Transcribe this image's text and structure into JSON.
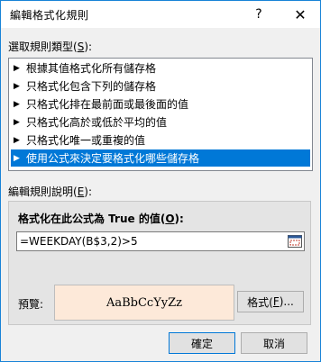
{
  "window": {
    "title": "編輯格式化規則",
    "help_glyph": "?",
    "close_glyph": "✕"
  },
  "rule_type": {
    "label": "選取規則類型(",
    "hotkey": "S",
    "label_end": "):",
    "items": [
      {
        "label": "根據其值格式化所有儲存格",
        "selected": false
      },
      {
        "label": "只格式化包含下列的儲存格",
        "selected": false
      },
      {
        "label": "只格式化排在最前面或最後面的值",
        "selected": false
      },
      {
        "label": "只格式化高於或低於平均的值",
        "selected": false
      },
      {
        "label": "只格式化唯一或重複的值",
        "selected": false
      },
      {
        "label": "使用公式來決定要格式化哪些儲存格",
        "selected": true
      }
    ]
  },
  "rule_description": {
    "label": "編輯規則說明(",
    "hotkey": "E",
    "label_end": "):",
    "formula_label": "格式化在此公式為 True 的值(",
    "formula_hotkey": "O",
    "formula_label_end": "):",
    "formula_value": "=WEEKDAY(B$3,2)>5",
    "preview_label": "預覽:",
    "preview_text": "AaBbCcYyZz",
    "format_button": "格式(",
    "format_hotkey": "F",
    "format_button_end": ")..."
  },
  "buttons": {
    "ok": "確定",
    "cancel": "取消"
  },
  "colors": {
    "selection": "#0078d7",
    "preview_fill": "#fde9d9",
    "window_border": "#1883d7"
  }
}
